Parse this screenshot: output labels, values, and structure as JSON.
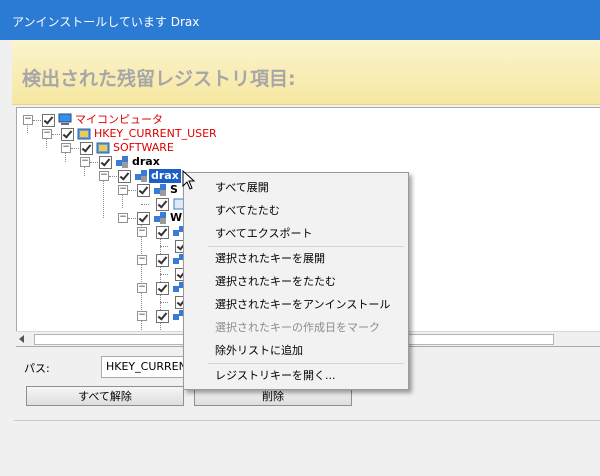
{
  "window": {
    "title": "アンインストールしています Drax"
  },
  "header": {
    "title": "検出された残留レジストリ項目:"
  },
  "tree": {
    "my_computer": "マイコンピュータ",
    "hkcu": "HKEY_CURRENT_USER",
    "software": "SOFTWARE",
    "drax": "drax",
    "drax_selected": "drax",
    "child_s": "S",
    "child_w": "W"
  },
  "path": {
    "label": "パス:",
    "value": "HKEY_CURREN"
  },
  "buttons": {
    "clear_all": "すべて解除",
    "delete": "削除"
  },
  "context_menu": {
    "expand_all": "すべて展開",
    "collapse_all": "すべてたたむ",
    "export_all": "すべてエクスポート",
    "expand_selected": "選択されたキーを展開",
    "collapse_selected": "選択されたキーをたたむ",
    "uninstall_selected": "選択されたキーをアンインストール",
    "mark_created_date": "選択されたキーの作成日をマーク",
    "add_exclusion": "除外リストに追加",
    "open_registry_key": "レジストリキーを開く..."
  },
  "colors": {
    "titlebar": "#2b7bd4",
    "header_bg": "#f6e7a0",
    "header_text": "#a7a7a7",
    "selection": "#1b5fc9",
    "red_text": "#e00000"
  }
}
